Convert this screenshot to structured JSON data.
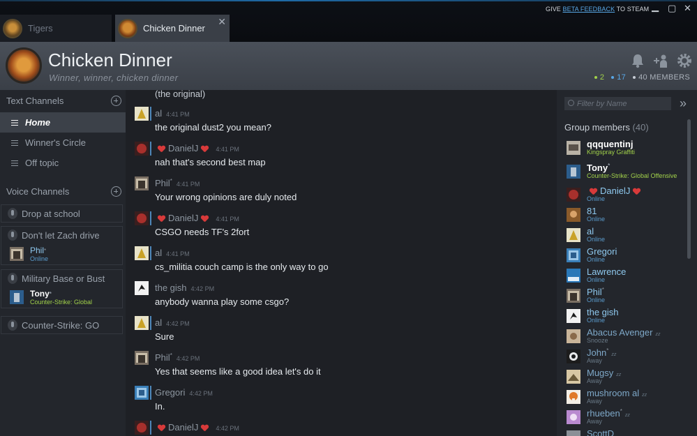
{
  "window": {
    "tabs": [
      {
        "label": "Tigers"
      },
      {
        "label": "Chicken Dinner"
      }
    ],
    "feedback": {
      "prefix": "GIVE ",
      "link": "BETA FEEDBACK",
      "suffix": " TO STEAM"
    }
  },
  "header": {
    "title": "Chicken Dinner",
    "subtitle": "Winner, winner, chicken dinner",
    "stats": {
      "in_game": "2",
      "online": "17",
      "members": "40 MEMBERS"
    },
    "stat_colors": {
      "in_game": "#a2d24a",
      "online": "#58a7e6",
      "members": "#c6ccd4"
    }
  },
  "sidebar": {
    "text_channels_label": "Text Channels",
    "text_channels": [
      {
        "label": "Home"
      },
      {
        "label": "Winner's Circle"
      },
      {
        "label": "Off topic"
      }
    ],
    "voice_channels_label": "Voice Channels",
    "voice_channels": [
      {
        "label": "Drop at school"
      },
      {
        "label": "Don't let Zach drive",
        "user": {
          "name": "Phil",
          "status": "Online"
        }
      },
      {
        "label": "Military Base or Bust",
        "user": {
          "name": "Tony",
          "status": "Counter-Strike: Global"
        }
      },
      {
        "label": "Counter-Strike: GO"
      }
    ]
  },
  "chat": {
    "cut_text": "(the original)",
    "messages": [
      {
        "author": "al",
        "time": "4:41 PM",
        "text": "the original dust2 you mean?"
      },
      {
        "author": "DanielJ",
        "time": "4:41 PM",
        "text": "nah that's second best map"
      },
      {
        "author": "Phil",
        "time": "4:41 PM",
        "text": "Your wrong opinions are duly noted"
      },
      {
        "author": "DanielJ",
        "time": "4:41 PM",
        "text": "CSGO needs TF's 2fort"
      },
      {
        "author": "al",
        "time": "4:41 PM",
        "text": "cs_militia couch camp is the only way to go"
      },
      {
        "author": "the gish",
        "time": "4:42 PM",
        "text": "anybody wanna play some csgo?"
      },
      {
        "author": "al",
        "time": "4:42 PM",
        "text": "Sure"
      },
      {
        "author": "Phil",
        "time": "4:42 PM",
        "text": "Yes that seems like a good idea let's do it"
      },
      {
        "author": "Gregori",
        "time": "4:42 PM",
        "text": "In."
      },
      {
        "author": "DanielJ",
        "time": "4:42 PM",
        "text": ""
      }
    ]
  },
  "members": {
    "filter_placeholder": "Filter by Name",
    "heading": "Group members",
    "count": "(40)",
    "list": [
      {
        "name": "qqquentinj",
        "status": "Kingspray Graffiti"
      },
      {
        "name": "Tony",
        "status": "Counter-Strike: Global Offensive"
      },
      {
        "name": "DanielJ",
        "status": "Online"
      },
      {
        "name": "81",
        "status": "Online"
      },
      {
        "name": "al",
        "status": "Online"
      },
      {
        "name": "Gregori",
        "status": "Online"
      },
      {
        "name": "Lawrence",
        "status": "Online"
      },
      {
        "name": "Phil",
        "status": "Online"
      },
      {
        "name": "the gish",
        "status": "Online"
      },
      {
        "name": "Abacus Avenger",
        "status": "Snooze"
      },
      {
        "name": "John",
        "status": "Away"
      },
      {
        "name": "Mugsy",
        "status": "Away"
      },
      {
        "name": "mushroom al",
        "status": "Away"
      },
      {
        "name": "rhueben",
        "status": "Away"
      },
      {
        "name": "ScottD",
        "status": ""
      }
    ]
  }
}
